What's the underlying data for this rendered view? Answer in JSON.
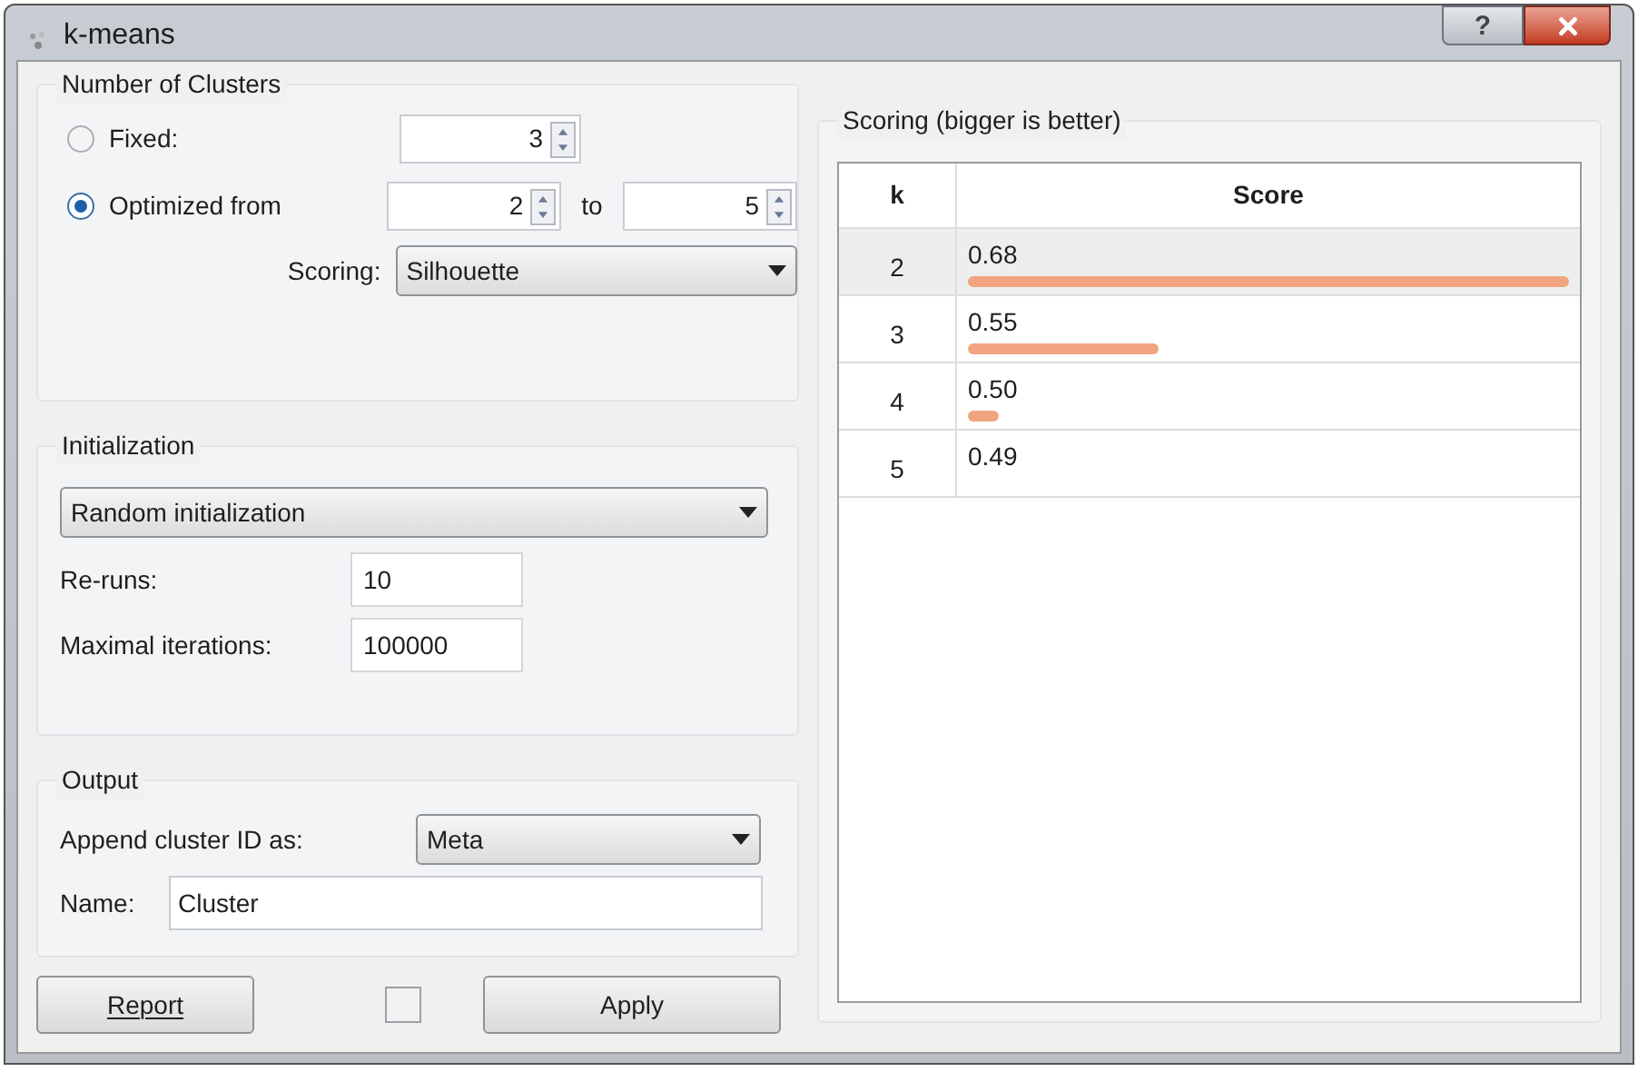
{
  "window": {
    "title": "k-means",
    "help": "?"
  },
  "clusters": {
    "title": "Number of Clusters",
    "options": [
      {
        "label": "Fixed:",
        "selected": false
      },
      {
        "label": "Optimized from",
        "selected": true
      }
    ],
    "fixed_value": "3",
    "from_value": "2",
    "to_label": "to",
    "to_value": "5",
    "scoring_label": "Scoring:",
    "scoring_value": "Silhouette"
  },
  "initialization": {
    "title": "Initialization",
    "method": "Random initialization",
    "reruns_label": "Re-runs:",
    "reruns_value": "10",
    "iterations_label": "Maximal iterations:",
    "iterations_value": "100000"
  },
  "output": {
    "title": "Output",
    "append_label": "Append cluster ID as:",
    "append_value": "Meta",
    "name_label": "Name:",
    "name_value": "Cluster"
  },
  "footer": {
    "report": "Report",
    "auto_apply_checked": false,
    "apply": "Apply"
  },
  "scoring": {
    "title": "Scoring (bigger is better)",
    "columns": [
      "k",
      "Score"
    ],
    "rows": [
      {
        "k": "2",
        "score": "0.68",
        "selected": true
      },
      {
        "k": "3",
        "score": "0.55",
        "selected": false
      },
      {
        "k": "4",
        "score": "0.50",
        "selected": false
      },
      {
        "k": "5",
        "score": "0.49",
        "selected": false
      }
    ]
  }
}
